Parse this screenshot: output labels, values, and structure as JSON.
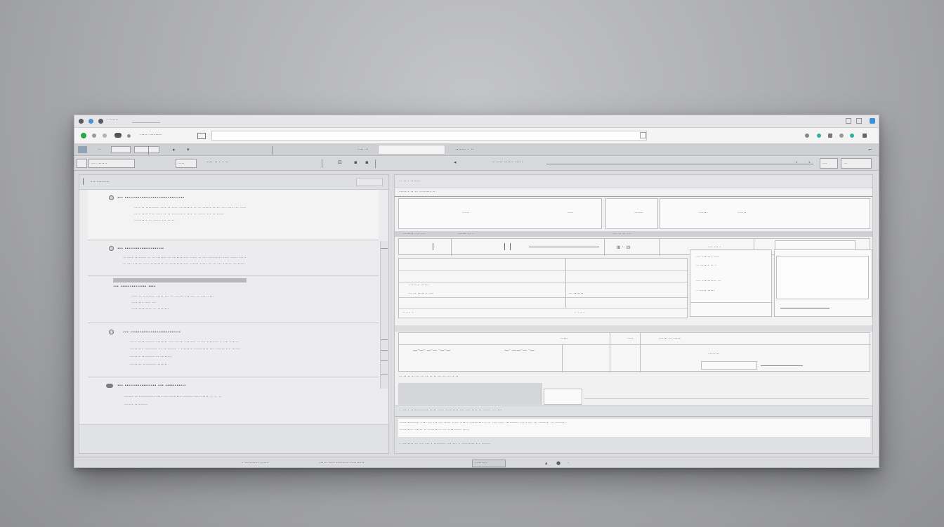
{
  "window": {
    "title": "· ······",
    "controls": [
      "minimize-icon",
      "maximize-icon",
      "close-icon"
    ]
  },
  "address": {
    "label": "····· ········",
    "value": "",
    "placeholder": ""
  },
  "toolbar1": {
    "item1": "··",
    "tab_label": "···· ··",
    "title": "······· · ··"
  },
  "toolbar2": {
    "left_label": "··· ·······",
    "mid1": "····",
    "mid2": "···· ·· ·  · ··",
    "mid3": "·· ···· ······ ·····",
    "right_btn": "···",
    "right_btn2": "··"
  },
  "left_pane": {
    "header": "··· ········",
    "items": [
      {
        "title": "··· ································",
        "lines": [
          "···· ·· ········· ···· ·· ···· ········· ·· ·· ······ ····· ··· ···· ··· ····",
          "···· ········· ···· ·· ·· ········· ···· ·· ····· ··· ········",
          "········· ·· ····· ··· ·····"
        ]
      },
      {
        "title": "··· ·····················",
        "lines": [
          "·· ···· ········ ·· ·· ······· ·· ··········· ····· ·· ··· ········· ···· ····· ·····",
          "·· ··· ······ ···· ········· ·· ············· ······ ····· ·· ·· ··· ······ ········"
        ]
      },
      {
        "title": "··· ·············· ····",
        "lines": [
          "···· ·· ········ ····· ··· ·· ······ ······· ·· ···· ····",
          "········ ···· ···",
          "·············· ·· ········"
        ]
      },
      {
        "title": "··· ···························",
        "lines": [
          "···· ············ ········ ··· ······ ······· ·· ··· ········ · ···· ······",
          "········· ········· ·· ·· ······ · ········ ·········· ··· ······ ··· ······",
          "······· ········· ·· ········",
          "········ ········· ·······"
        ]
      },
      {
        "title": "··· ················· ··· ···········",
        "lines": [
          "······ ·· ··········· ···· ··· ········ ······· ···· ····· ·· ·· ··",
          "······ ·········"
        ]
      }
    ]
  },
  "right_pane": {
    "top": "·· ···· ·······",
    "sub": "······· ·· ·· ········ ··",
    "boxes": {
      "a": "·····",
      "b": "····",
      "c": "······",
      "d": "······",
      "e": "······"
    },
    "row_labels": [
      "········ ·· ···",
      "······ ·· ·",
      "··· ·· ·· ···"
    ],
    "panel_lines": [
      "··· ······· ····",
      "·· ······ ·· ·",
      "··· ·········· ··",
      "· ····· ·····"
    ],
    "mid_lines": [
      "······· ······",
      "·· ·· ····· · ···",
      "·· ·······"
    ],
    "lower": [
      "·····",
      "····",
      "······ ·· ·····",
      "········"
    ],
    "footer": "· ····· ············ ····· ···· ········· ··· ··· ···· ·· ····· ·· ····",
    "footer2": "··············· ···· ··· ··· ··· ····· ····· ······ ·········· ·· ·· ···· ···· ·········· ····· ··· ··· ········ ·· ········",
    "footer3": "· ········ ·· ··· ··· · ········ ··· ··· · ········· ··· ······"
  },
  "statusbar": {
    "left": "· ········· ·····",
    "mid": "····· ···· ········ ·········",
    "right": "·········",
    "icons": [
      "lock-icon",
      "settings-icon",
      "info-icon"
    ]
  },
  "colors": {
    "accent_green": "#2aa745",
    "accent_blue": "#3d8fd6",
    "teal": "#2fb3a0"
  }
}
